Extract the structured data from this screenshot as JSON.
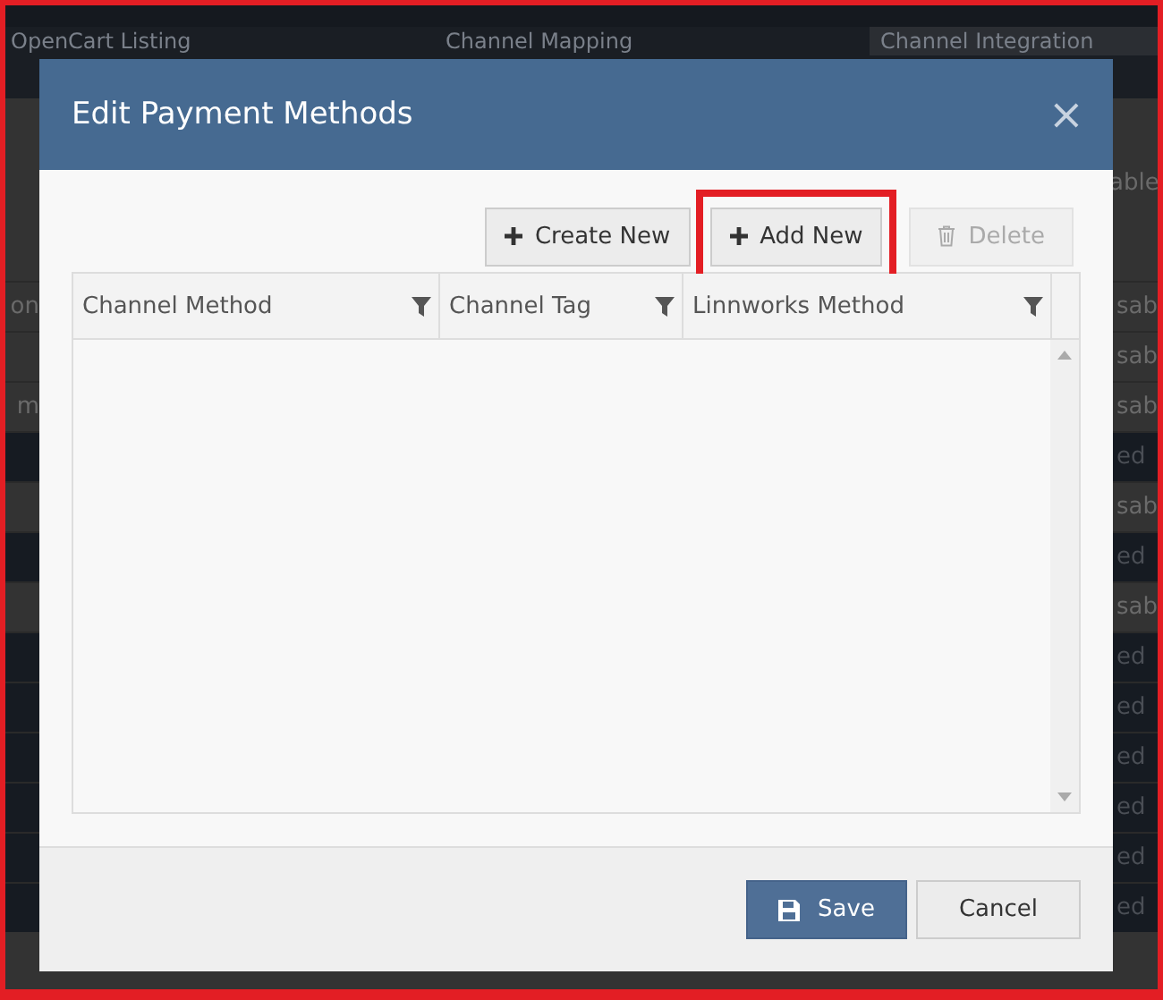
{
  "background": {
    "tabs": [
      {
        "label": "OpenCart Listing",
        "selected": false
      },
      {
        "label": "Channel Mapping",
        "selected": false
      },
      {
        "label": "Channel Integration",
        "selected": true
      }
    ],
    "top_status": "able",
    "rows": [
      {
        "left": "on",
        "status": "sab",
        "highlighted": false
      },
      {
        "status": "sab",
        "highlighted": false
      },
      {
        "left": "m",
        "status": "sab",
        "highlighted": false
      },
      {
        "status": "ed",
        "highlighted": true
      },
      {
        "status": "sab",
        "highlighted": false
      },
      {
        "status": "ed",
        "highlighted": true
      },
      {
        "status": "sab",
        "highlighted": false
      },
      {
        "status": "ed",
        "highlighted": true
      },
      {
        "status": "ed",
        "highlighted": true
      },
      {
        "status": "ed",
        "highlighted": true
      },
      {
        "status": "ed",
        "highlighted": true
      },
      {
        "status": "ed",
        "highlighted": true
      },
      {
        "status": "ed",
        "highlighted": true
      }
    ]
  },
  "dialog": {
    "title": "Edit Payment Methods",
    "close": "×",
    "toolbar": [
      {
        "label": "Create New",
        "kind": "add",
        "disabled": false,
        "highlighted": false
      },
      {
        "label": "Add New",
        "kind": "add",
        "disabled": false,
        "highlighted": true
      },
      {
        "label": "Delete",
        "kind": "delete",
        "disabled": true,
        "highlighted": false
      }
    ],
    "table": {
      "columns": [
        "Channel Method",
        "Channel Tag",
        "Linnworks Method"
      ]
    },
    "buttons": [
      {
        "label": "Save",
        "kind": "primary"
      },
      {
        "label": "Cancel",
        "kind": "secondary"
      }
    ]
  }
}
